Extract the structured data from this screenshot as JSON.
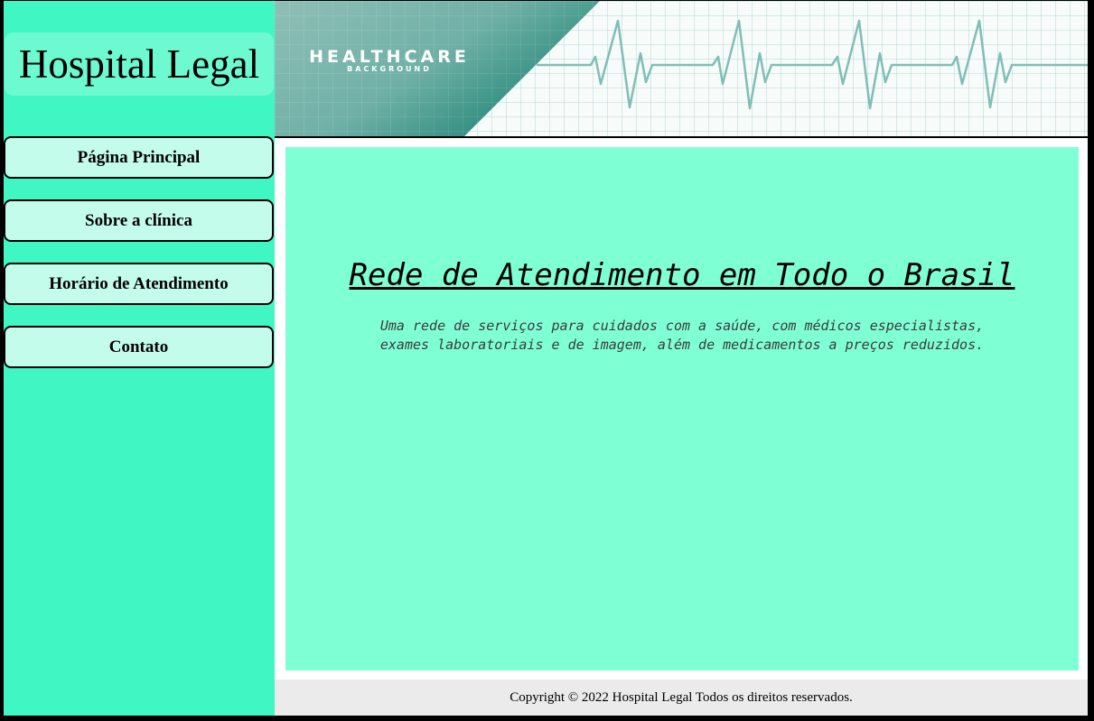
{
  "sidebar": {
    "logo": "Hospital Legal",
    "nav": [
      {
        "label": "Página Principal"
      },
      {
        "label": "Sobre a clínica"
      },
      {
        "label": "Horário de Atendimento"
      },
      {
        "label": "Contato"
      }
    ]
  },
  "banner": {
    "title": "HEALTHCARE",
    "subtitle": "BACKGROUND",
    "icon": "heartbeat-line-icon"
  },
  "main": {
    "headline": "Rede de Atendimento em Todo o Brasil",
    "lead": "Uma rede de serviços para cuidados com a saúde, com médicos especialistas, exames laboratoriais e de imagem, além de medicamentos a preços reduzidos."
  },
  "footer": {
    "copyright": "Copyright © 2022 Hospital Legal Todos os direitos reservados."
  },
  "colors": {
    "sidebar": "#40f7c4",
    "main_panel": "#7fffd4",
    "nav_button": "#c4fceb",
    "banner_teal": "#2f8f80",
    "heartbeat": "#7fbfb5"
  }
}
